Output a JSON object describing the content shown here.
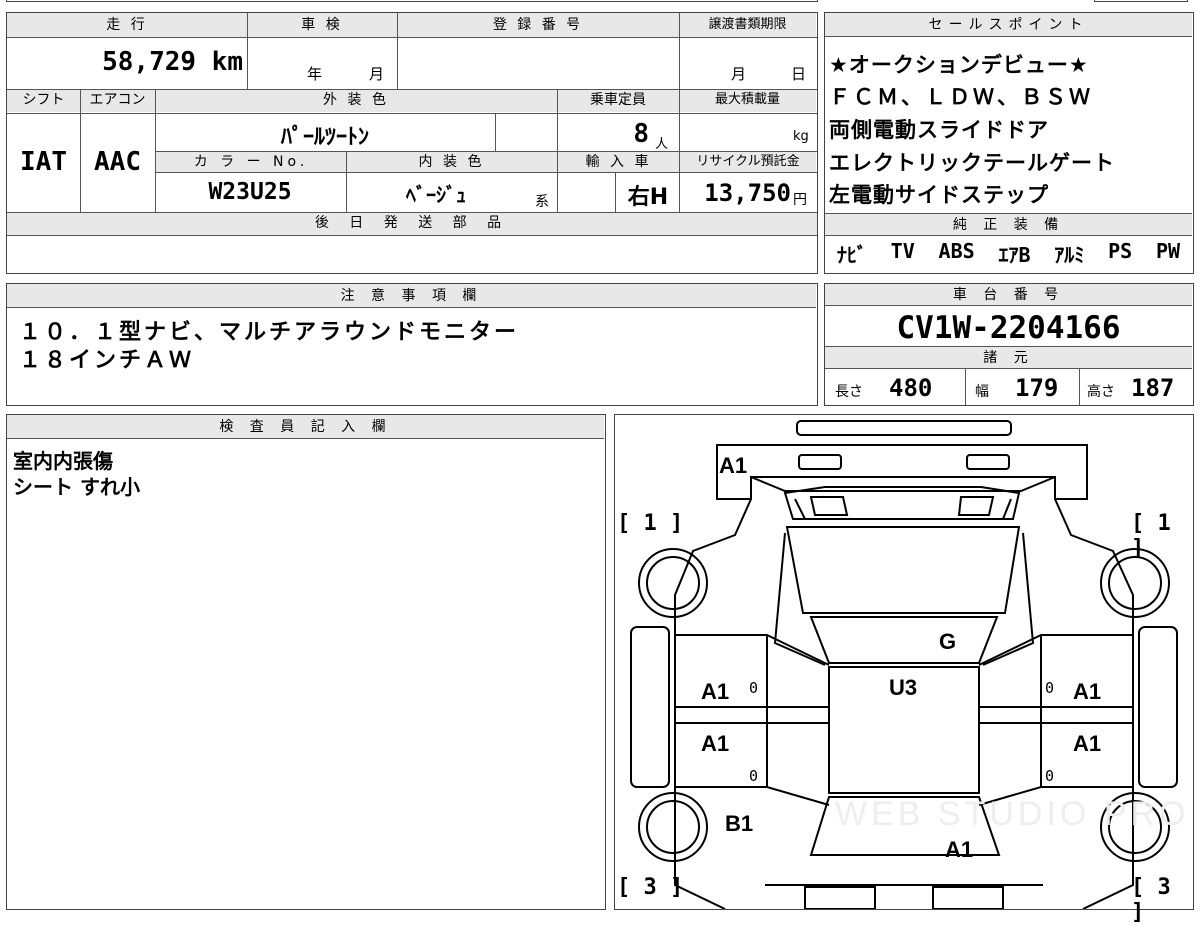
{
  "vehicle": {
    "mileage_label": "走 行",
    "mileage": "58,729 km",
    "inspection_label": "車 検",
    "inspection_year_unit": "年",
    "inspection_month_unit": "月",
    "registration_label": "登 録 番 号",
    "transfer_label": "譲渡書類期限",
    "transfer_month_unit": "月",
    "transfer_day_unit": "日",
    "shift_label": "シフト",
    "shift": "IAT",
    "ac_label": "エアコン",
    "ac": "AAC",
    "exterior_label": "外 装 色",
    "exterior": "ﾊﾟｰﾙﾂｰﾄﾝ",
    "color_no_label": "カ ラ ー No.",
    "color_no": "W23U25",
    "interior_label": "内 装 色",
    "interior": "ﾍﾞｰｼﾞｭ",
    "interior_suffix": "系",
    "capacity_label": "乗車定員",
    "capacity": "8",
    "capacity_unit": "人",
    "max_load_label": "最大積載量",
    "max_load_unit": "kg",
    "import_label": "輸 入 車",
    "handle": "右H",
    "recycle_label": "リサイクル預託金",
    "recycle": "13,750",
    "recycle_unit": "円",
    "later_parts_label": "後 日 発 送 部 品"
  },
  "sales_points": {
    "label": "セールスポイント",
    "lines": [
      "★オークションデビュー★",
      "ＦＣＭ、ＬＤＷ、ＢＳＷ",
      "両側電動スライドドア",
      "エレクトリックテールゲート",
      "左電動サイドステップ"
    ]
  },
  "equipment": {
    "label": "純 正 装 備",
    "items": [
      "ﾅﾋﾞ",
      "TV",
      "ABS",
      "ｴｱB",
      "ｱﾙﾐ",
      "PS",
      "PW"
    ]
  },
  "notes": {
    "label": "注 意 事 項 欄",
    "lines": [
      "１０．１型ナビ、マルチアラウンドモニター",
      "１８インチＡＷ"
    ]
  },
  "chassis": {
    "label": "車 台 番 号",
    "number": "CV1W-2204166",
    "specs_label": "諸 元",
    "length_label": "長さ",
    "length": "480",
    "width_label": "幅",
    "width": "179",
    "height_label": "高さ",
    "height": "187"
  },
  "inspector": {
    "label": "検 査 員 記 入 欄",
    "lines": [
      "室内内張傷",
      "シート すれ小"
    ]
  },
  "diagram": {
    "marks": {
      "front": "A1",
      "hood": "G",
      "roof": "U3",
      "left_front_door": "A1",
      "right_front_door": "A1",
      "left_rear_door": "A1",
      "right_rear_door": "A1",
      "left_rear_fender": "B1",
      "rear": "A1"
    },
    "zero": "0",
    "grade_front_left": "[ 1 ]",
    "grade_front_right": "[ 1 ]",
    "grade_rear_left": "[ 3 ]",
    "grade_rear_right": "[ 3 ]",
    "watermark": "WEB STUDIO PRO"
  }
}
